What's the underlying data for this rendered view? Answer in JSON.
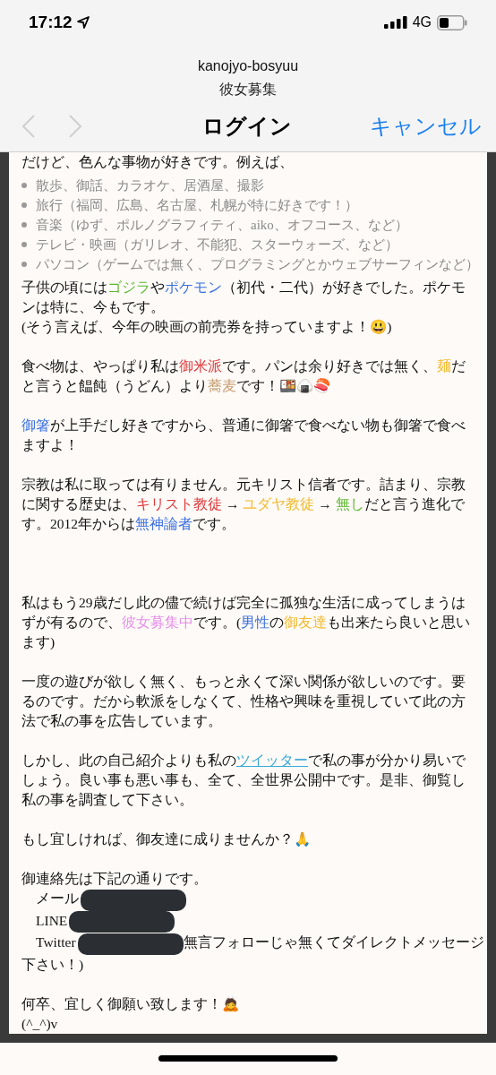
{
  "status_bar": {
    "time": "17:12",
    "network": "4G"
  },
  "header": {
    "title": "kanojyo-bosyuu",
    "subtitle": "彼女募集"
  },
  "nav": {
    "title": "ログイン",
    "cancel": "キャンセル",
    "back_disabled": true,
    "forward_disabled": true
  },
  "content": [
    {
      "kind": "paragraph",
      "segments": [
        {
          "text": "だけど、色んな事物が好きです。例えば、"
        }
      ]
    },
    {
      "kind": "list",
      "items": [
        "散歩、御話、カラオケ、居酒屋、撮影",
        "旅行（福岡、広島、名古屋、札幌が特に好きです！）",
        "音楽（ゆず、ポルノグラフィティ、aiko、オフコース、など）",
        "テレビ・映画（ガリレオ、不能犯、スターウォーズ、など）",
        "パソコン（ゲームでは無く、プログラミングとかウェブサーフィンなど）"
      ]
    },
    {
      "kind": "paragraph",
      "segments": [
        {
          "text": "子供の頃には"
        },
        {
          "text": "ゴジラ",
          "color": "#5cb82e"
        },
        {
          "text": "や"
        },
        {
          "text": "ポケモン",
          "color": "#3b6fe0"
        },
        {
          "text": "（初代・二代）が好きでした。ポケモンは特に、今もです。"
        }
      ]
    },
    {
      "kind": "paragraph",
      "segments": [
        {
          "text": "(そう言えば、今年の映画の前売券を持っていますよ！😃)"
        }
      ]
    },
    {
      "kind": "blank"
    },
    {
      "kind": "paragraph",
      "segments": [
        {
          "text": "食べ物は、やっぱり私は"
        },
        {
          "text": "御米派",
          "color": "#e0383b"
        },
        {
          "text": "です。パンは余り好きでは無く、"
        },
        {
          "text": "麺",
          "color": "#f2b92e"
        },
        {
          "text": "だと言うと饂飩（うどん）より"
        },
        {
          "text": "蕎麦",
          "color": "#c49a6c"
        },
        {
          "text": "です！🍱🍙🍣"
        }
      ]
    },
    {
      "kind": "blank"
    },
    {
      "kind": "paragraph",
      "segments": [
        {
          "text": "御箸",
          "color": "#3b6fe0"
        },
        {
          "text": "が上手だし好きですから、普通に御箸で食べない物も御箸で食べますよ！"
        }
      ]
    },
    {
      "kind": "blank"
    },
    {
      "kind": "paragraph",
      "segments": [
        {
          "text": "宗教は私に取っては有りません。元キリスト信者です。詰まり、宗教に関する歴史は、"
        },
        {
          "text": "キリスト教徒",
          "color": "#e0383b"
        },
        {
          "text": " → "
        },
        {
          "text": "ユダヤ教徒",
          "color": "#f2b92e"
        },
        {
          "text": " → "
        },
        {
          "text": "無し",
          "color": "#5cb82e"
        },
        {
          "text": "だと言う進化です。2012年からは"
        },
        {
          "text": "無神論者",
          "color": "#3b6fe0"
        },
        {
          "text": "です。"
        }
      ]
    },
    {
      "kind": "blank"
    },
    {
      "kind": "blank"
    },
    {
      "kind": "blank"
    },
    {
      "kind": "paragraph",
      "segments": [
        {
          "text": "私はもう29歳だし此の儘で続けば完全に孤独な生活に成ってしまうはずが有るので、"
        },
        {
          "text": "彼女募集中",
          "color": "#e58fe8"
        },
        {
          "text": "です。("
        },
        {
          "text": "男性",
          "color": "#3b6fe0"
        },
        {
          "text": "の"
        },
        {
          "text": "御友達",
          "color": "#f2b92e"
        },
        {
          "text": "も出来たら良いと思います)"
        }
      ]
    },
    {
      "kind": "blank"
    },
    {
      "kind": "paragraph",
      "segments": [
        {
          "text": "一度の遊びが欲しく無く、もっと永くて深い関係が欲しいのです。要るのです。だから軟派をしなくて、性格や興味を重視していて此の方法で私の事を広告しています。"
        }
      ]
    },
    {
      "kind": "blank"
    },
    {
      "kind": "paragraph",
      "segments": [
        {
          "text": "しかし、此の自己紹介よりも私の"
        },
        {
          "text": "ツイッター",
          "kind": "link"
        },
        {
          "text": "で私の事が分かり易いでしょう。良い事も悪い事も、全て、全世界公開中です。是非、御覧し私の事を調査して下さい。"
        }
      ]
    },
    {
      "kind": "blank"
    },
    {
      "kind": "paragraph",
      "segments": [
        {
          "text": "もし宜しければ、御友達に成りませんか？🙏"
        }
      ]
    },
    {
      "kind": "blank"
    },
    {
      "kind": "paragraph",
      "segments": [
        {
          "text": "御連絡先は下記の通りです。"
        }
      ]
    },
    {
      "kind": "contact",
      "label": "メール",
      "redacted": true
    },
    {
      "kind": "contact",
      "label": "LINE",
      "redacted": true
    },
    {
      "kind": "contact",
      "label": "Twitter",
      "redacted": true,
      "note": "無言フォローじゃ無くてダイレクトメッセージ"
    },
    {
      "kind": "paragraph",
      "segments": [
        {
          "text": "下さい！)"
        }
      ]
    },
    {
      "kind": "blank"
    },
    {
      "kind": "paragraph",
      "segments": [
        {
          "text": "何卒、宜しく御願い致します！🙇"
        }
      ]
    },
    {
      "kind": "paragraph",
      "segments": [
        {
          "text": "(^_^)v"
        }
      ]
    }
  ]
}
